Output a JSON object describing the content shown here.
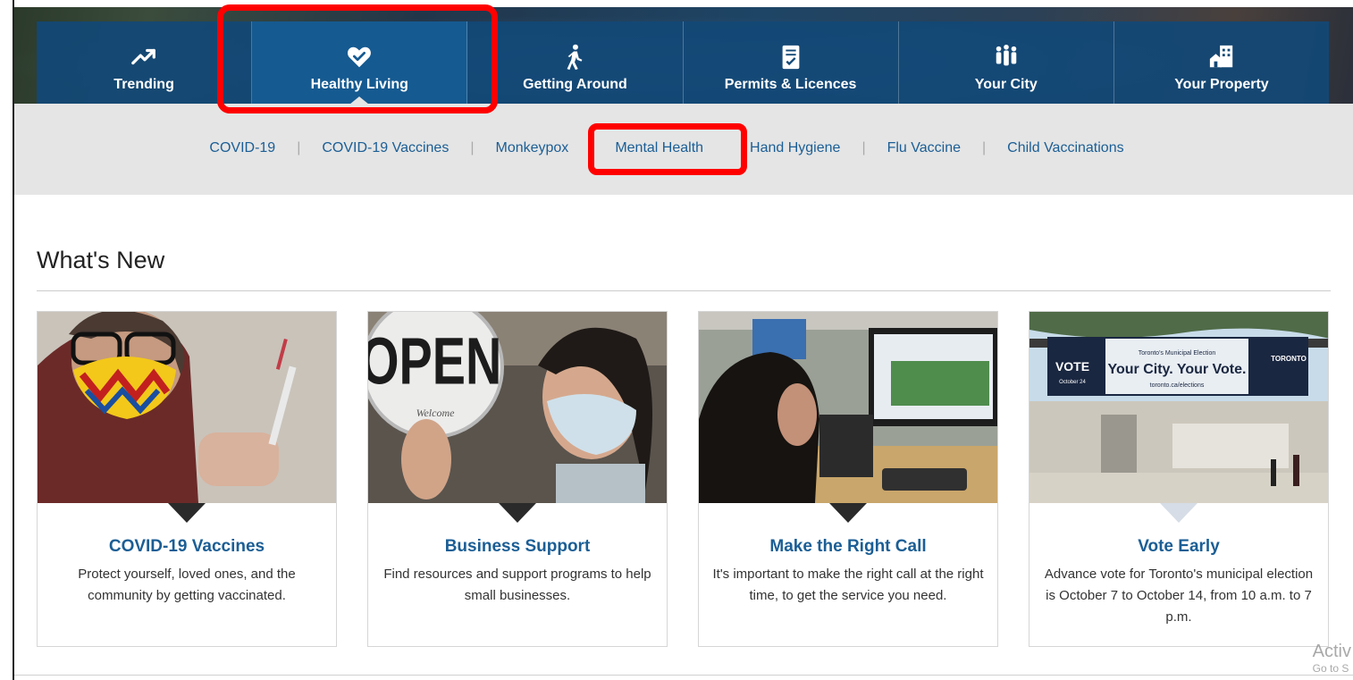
{
  "main_nav": {
    "items": [
      {
        "label": "Trending",
        "icon": "trending-icon"
      },
      {
        "label": "Healthy Living",
        "icon": "heart-icon"
      },
      {
        "label": "Getting Around",
        "icon": "walking-icon"
      },
      {
        "label": "Permits & Licences",
        "icon": "permit-icon"
      },
      {
        "label": "Your City",
        "icon": "people-icon"
      },
      {
        "label": "Your Property",
        "icon": "house-icon"
      }
    ],
    "active": "Healthy Living"
  },
  "sub_nav": {
    "items": [
      "COVID-19",
      "COVID-19 Vaccines",
      "Monkeypox",
      "Mental Health",
      "Hand Hygiene",
      "Flu Vaccine",
      "Child Vaccinations"
    ],
    "separator": "|"
  },
  "whats_new": {
    "heading": "What's New",
    "cards": [
      {
        "title": "COVID-19 Vaccines",
        "text": "Protect yourself, loved ones, and the community by getting vaccinated."
      },
      {
        "title": "Business Support",
        "text": "Find resources and support programs to help small businesses."
      },
      {
        "title": "Make the Right Call",
        "text": "It's important to make the right call at the right time, to get the service you need."
      },
      {
        "title": "Vote Early",
        "text": "Advance vote for Toronto's municipal election is October 7 to October 14, from 10 a.m. to 7 p.m."
      }
    ]
  },
  "images": {
    "open_sign": "OPEN",
    "open_sub": "Welcome",
    "banner_vote": "VOTE",
    "banner_date": "October 24",
    "banner_top": "Toronto's Municipal Election",
    "banner_main": "Your City. Your Vote.",
    "banner_url": "toronto.ca/elections",
    "banner_logo": "TORONTO"
  },
  "watermark": {
    "line1": "Activ",
    "line2": "Go to S"
  },
  "colors": {
    "nav_blue": "#124876",
    "active_blue": "#155a91",
    "link_blue": "#1b5e95",
    "highlight": "#ff0000"
  }
}
